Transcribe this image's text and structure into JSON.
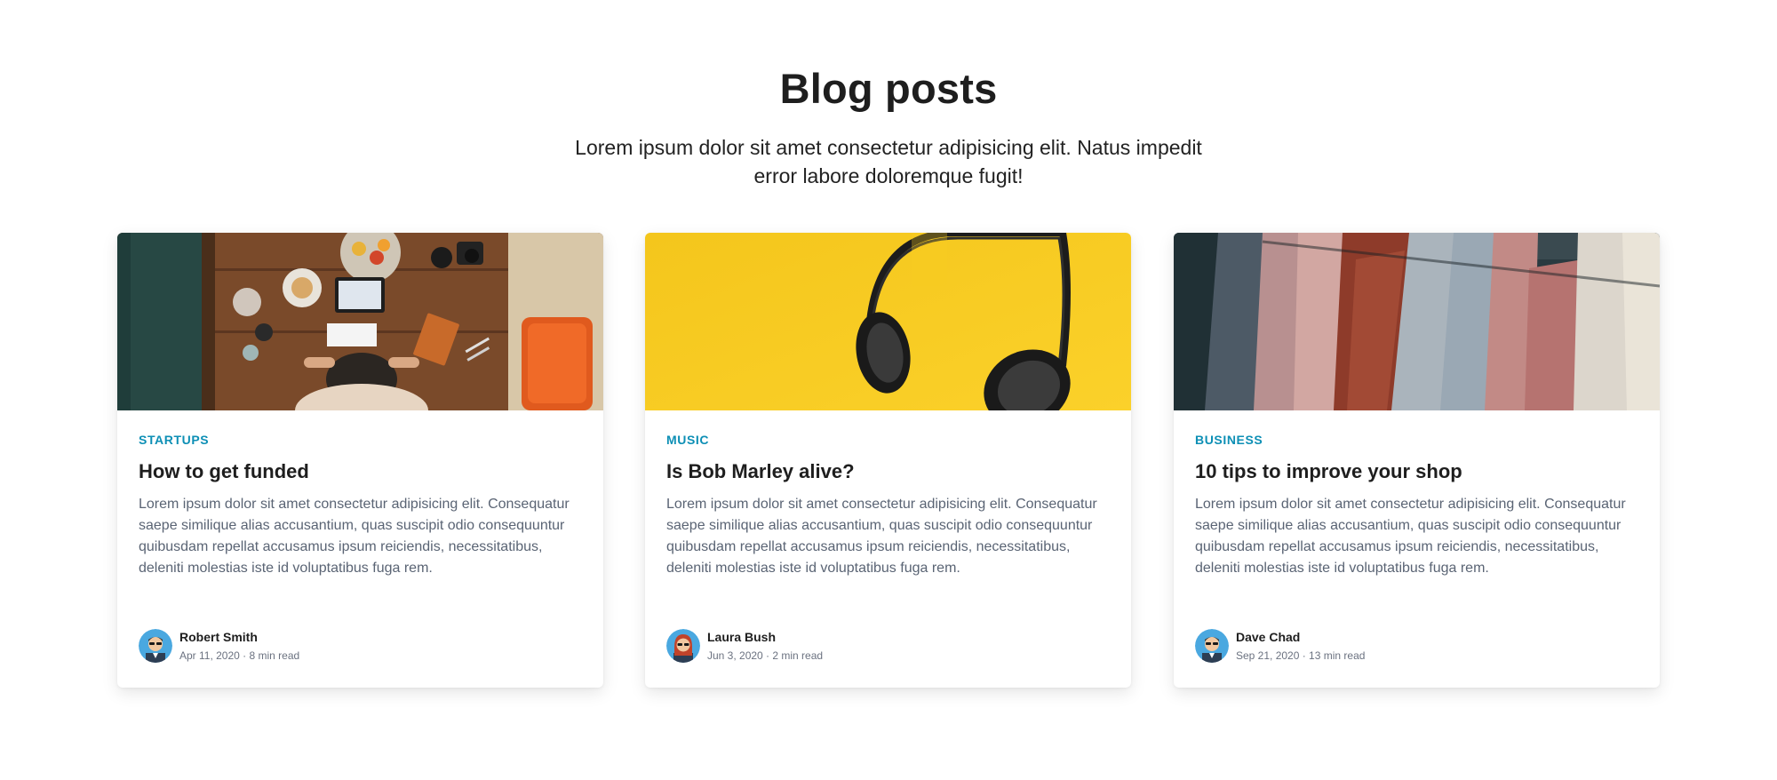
{
  "header": {
    "title": "Blog posts",
    "subtitle": "Lorem ipsum dolor sit amet consectetur adipisicing elit. Natus impedit error labore doloremque fugit!"
  },
  "colors": {
    "category": "#0d8fb5",
    "title": "#1e1e1e",
    "body_text": "#5a6474"
  },
  "posts": [
    {
      "image": "desk-workspace-photo",
      "category": "STARTUPS",
      "title": "How to get funded",
      "excerpt": "Lorem ipsum dolor sit amet consectetur adipisicing elit. Consequatur saepe similique alias accusantium, quas suscipit odio consequuntur quibusdam repellat accusamus ipsum reiciendis, necessitatibus, deleniti molestias iste id voluptatibus fuga rem.",
      "author": {
        "name": "Robert Smith",
        "meta": "Apr 11, 2020 · 8 min read",
        "avatar": "male-avatar-icon"
      }
    },
    {
      "image": "headphones-photo",
      "category": "MUSIC",
      "title": "Is Bob Marley alive?",
      "excerpt": "Lorem ipsum dolor sit amet consectetur adipisicing elit. Consequatur saepe similique alias accusantium, quas suscipit odio consequuntur quibusdam repellat accusamus ipsum reiciendis, necessitatibus, deleniti molestias iste id voluptatibus fuga rem.",
      "author": {
        "name": "Laura Bush",
        "meta": "Jun 3, 2020 · 2 min read",
        "avatar": "female-avatar-icon"
      }
    },
    {
      "image": "clothing-rack-photo",
      "category": "BUSINESS",
      "title": "10 tips to improve your shop",
      "excerpt": "Lorem ipsum dolor sit amet consectetur adipisicing elit. Consequatur saepe similique alias accusantium, quas suscipit odio consequuntur quibusdam repellat accusamus ipsum reiciendis, necessitatibus, deleniti molestias iste id voluptatibus fuga rem.",
      "author": {
        "name": "Dave Chad",
        "meta": "Sep 21, 2020 · 13 min read",
        "avatar": "male-avatar-icon"
      }
    }
  ]
}
